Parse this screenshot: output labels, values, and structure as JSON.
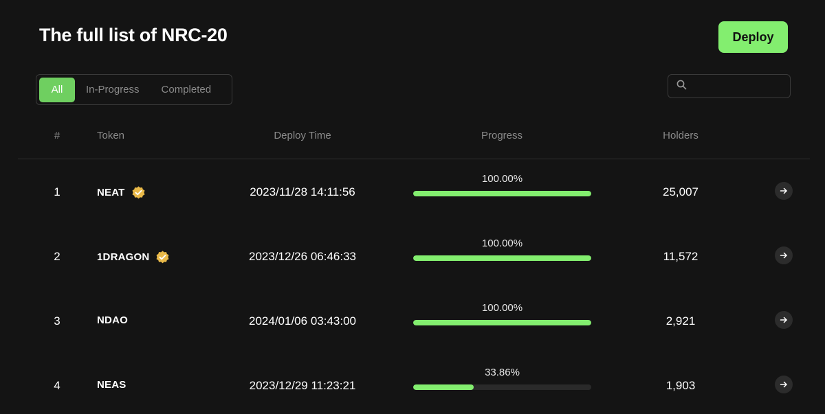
{
  "page": {
    "title": "The full list of NRC-20",
    "deploy_label": "Deploy"
  },
  "filters": {
    "tabs": [
      {
        "label": "All",
        "active": true
      },
      {
        "label": "In-Progress",
        "active": false
      },
      {
        "label": "Completed",
        "active": false
      }
    ]
  },
  "search": {
    "placeholder": "",
    "value": "",
    "icon": "search-icon"
  },
  "table": {
    "columns": [
      "#",
      "Token",
      "Deploy Time",
      "Progress",
      "Holders"
    ],
    "rows": [
      {
        "index": "1",
        "token": "NEAT",
        "verified": true,
        "deploy_time": "2023/11/28 14:11:56",
        "progress_label": "100.00%",
        "progress": 100.0,
        "holders": "25,007"
      },
      {
        "index": "2",
        "token": "1DRAGON",
        "verified": true,
        "deploy_time": "2023/12/26 06:46:33",
        "progress_label": "100.00%",
        "progress": 100.0,
        "holders": "11,572"
      },
      {
        "index": "3",
        "token": "NDAO",
        "verified": false,
        "deploy_time": "2024/01/06 03:43:00",
        "progress_label": "100.00%",
        "progress": 100.0,
        "holders": "2,921"
      },
      {
        "index": "4",
        "token": "NEAS",
        "verified": false,
        "deploy_time": "2023/12/29 11:23:21",
        "progress_label": "33.86%",
        "progress": 33.86,
        "holders": "1,903"
      }
    ]
  },
  "colors": {
    "background": "#141414",
    "accent": "#83ee6f",
    "active_tab": "#6fcf60",
    "muted_text": "#8a8a8a",
    "verified_badge": "#e9b949"
  }
}
